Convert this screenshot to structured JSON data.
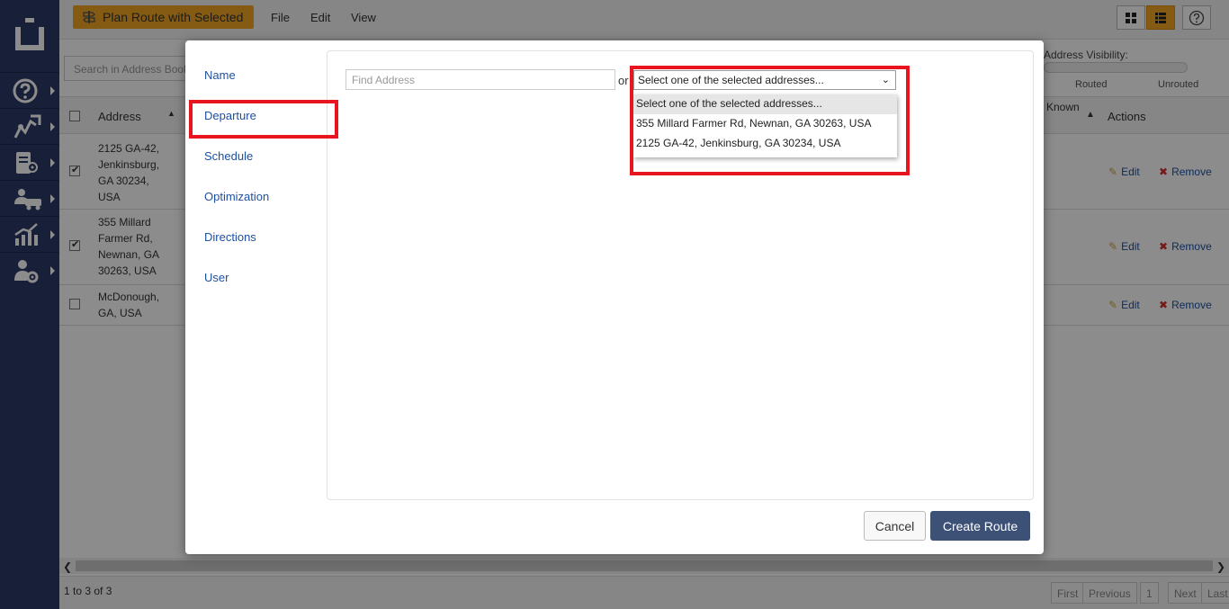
{
  "toolbar": {
    "plan_route_label": "Plan Route with Selected",
    "menu_file": "File",
    "menu_edit": "Edit",
    "menu_view": "View"
  },
  "sidebar": {
    "items": [
      {
        "icon": "help-icon"
      },
      {
        "icon": "routes-icon"
      },
      {
        "icon": "address-book-icon"
      },
      {
        "icon": "vehicles-icon"
      },
      {
        "icon": "analytics-icon"
      },
      {
        "icon": "user-settings-icon"
      }
    ]
  },
  "background": {
    "search_placeholder": "Search in Address Book",
    "visibility_label": "Address Visibility:",
    "visibility_routed": "Routed",
    "visibility_unrouted": "Unrouted",
    "columns": {
      "address": "Address",
      "known_partial": "Known",
      "actions": "Actions"
    },
    "rows": [
      {
        "lines": [
          "2125 GA-42,",
          "Jenkinsburg,",
          "GA 30234,",
          "USA"
        ],
        "checked": true
      },
      {
        "lines": [
          "355 Millard",
          "Farmer Rd,",
          "Newnan, GA",
          "30263, USA"
        ],
        "checked": true
      },
      {
        "lines": [
          "McDonough,",
          "GA, USA"
        ],
        "checked": false
      }
    ],
    "edit_label": "Edit",
    "remove_label": "Remove",
    "record_count": "1 to 3 of 3",
    "pager": {
      "first": "First",
      "previous": "Previous",
      "page": "1",
      "next": "Next",
      "last": "Last"
    }
  },
  "modal": {
    "tabs": {
      "name": "Name",
      "departure": "Departure",
      "schedule": "Schedule",
      "optimization": "Optimization",
      "directions": "Directions",
      "user": "User"
    },
    "find_address_placeholder": "Find Address",
    "or_text": "or",
    "select_value": "Select one of the selected addresses...",
    "options": [
      "Select one of the selected addresses...",
      "355 Millard Farmer Rd, Newnan, GA 30263, USA",
      "2125 GA-42, Jenkinsburg, GA 30234, USA"
    ],
    "cancel_label": "Cancel",
    "create_label": "Create Route"
  },
  "colors": {
    "nav_bg": "#2c3a66",
    "accent": "#f2a623",
    "link": "#1e50a2",
    "highlight": "#e8141f",
    "primary_button": "#3d5177"
  }
}
